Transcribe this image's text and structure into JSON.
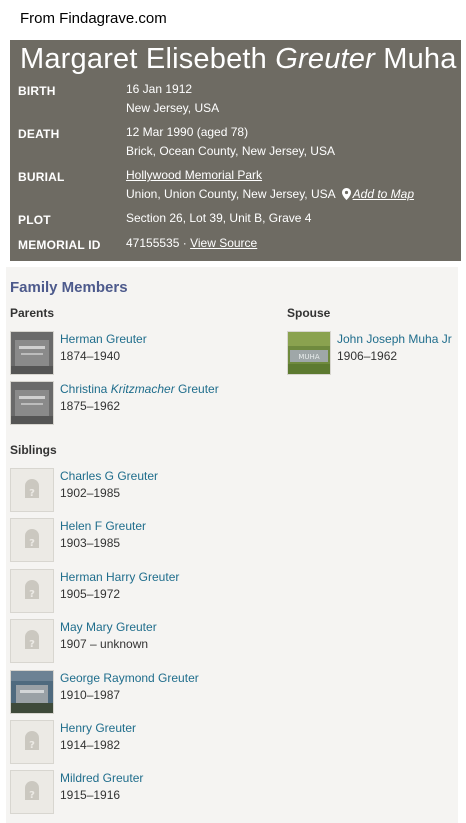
{
  "source_label": "From Findagrave.com",
  "memorial": {
    "name_first": "Margaret Elisebeth",
    "name_maiden": "Greuter",
    "name_last": "Muha",
    "birth_label": "BIRTH",
    "birth_date": "16 Jan 1912",
    "birth_place": "New Jersey, USA",
    "death_label": "DEATH",
    "death_date": "12 Mar 1990 (aged 78)",
    "death_place": "Brick, Ocean County, New Jersey, USA",
    "burial_label": "BURIAL",
    "burial_cemetery": "Hollywood Memorial Park",
    "burial_place": "Union, Union County, New Jersey, USA",
    "add_to_map": "Add to Map",
    "plot_label": "PLOT",
    "plot_value": "Section 26, Lot 39, Unit B, Grave 4",
    "memorial_id_label": "MEMORIAL ID",
    "memorial_id": "47155535 ·",
    "view_source": "View Source"
  },
  "family": {
    "title": "Family Members",
    "parents_label": "Parents",
    "spouse_label": "Spouse",
    "siblings_label": "Siblings",
    "parents": [
      {
        "name": "Herman Greuter",
        "dates": "1874–1940"
      },
      {
        "name_pre": "Christina ",
        "name_italic": "Kritzmacher",
        "name_post": " Greuter",
        "dates": "1875–1962"
      }
    ],
    "spouse": {
      "name": "John Joseph Muha Jr",
      "dates": "1906–1962",
      "stone_text": "MUHA"
    },
    "siblings": [
      {
        "name": "Charles G Greuter",
        "dates": "1902–1985"
      },
      {
        "name": "Helen F Greuter",
        "dates": "1903–1985"
      },
      {
        "name": "Herman Harry Greuter",
        "dates": "1905–1972"
      },
      {
        "name": "May Mary Greuter",
        "dates": "1907 – unknown"
      },
      {
        "name": "George Raymond Greuter",
        "dates": "1910–1987"
      },
      {
        "name": "Henry Greuter",
        "dates": "1914–1982"
      },
      {
        "name": "Mildred Greuter",
        "dates": "1915–1916"
      }
    ]
  }
}
